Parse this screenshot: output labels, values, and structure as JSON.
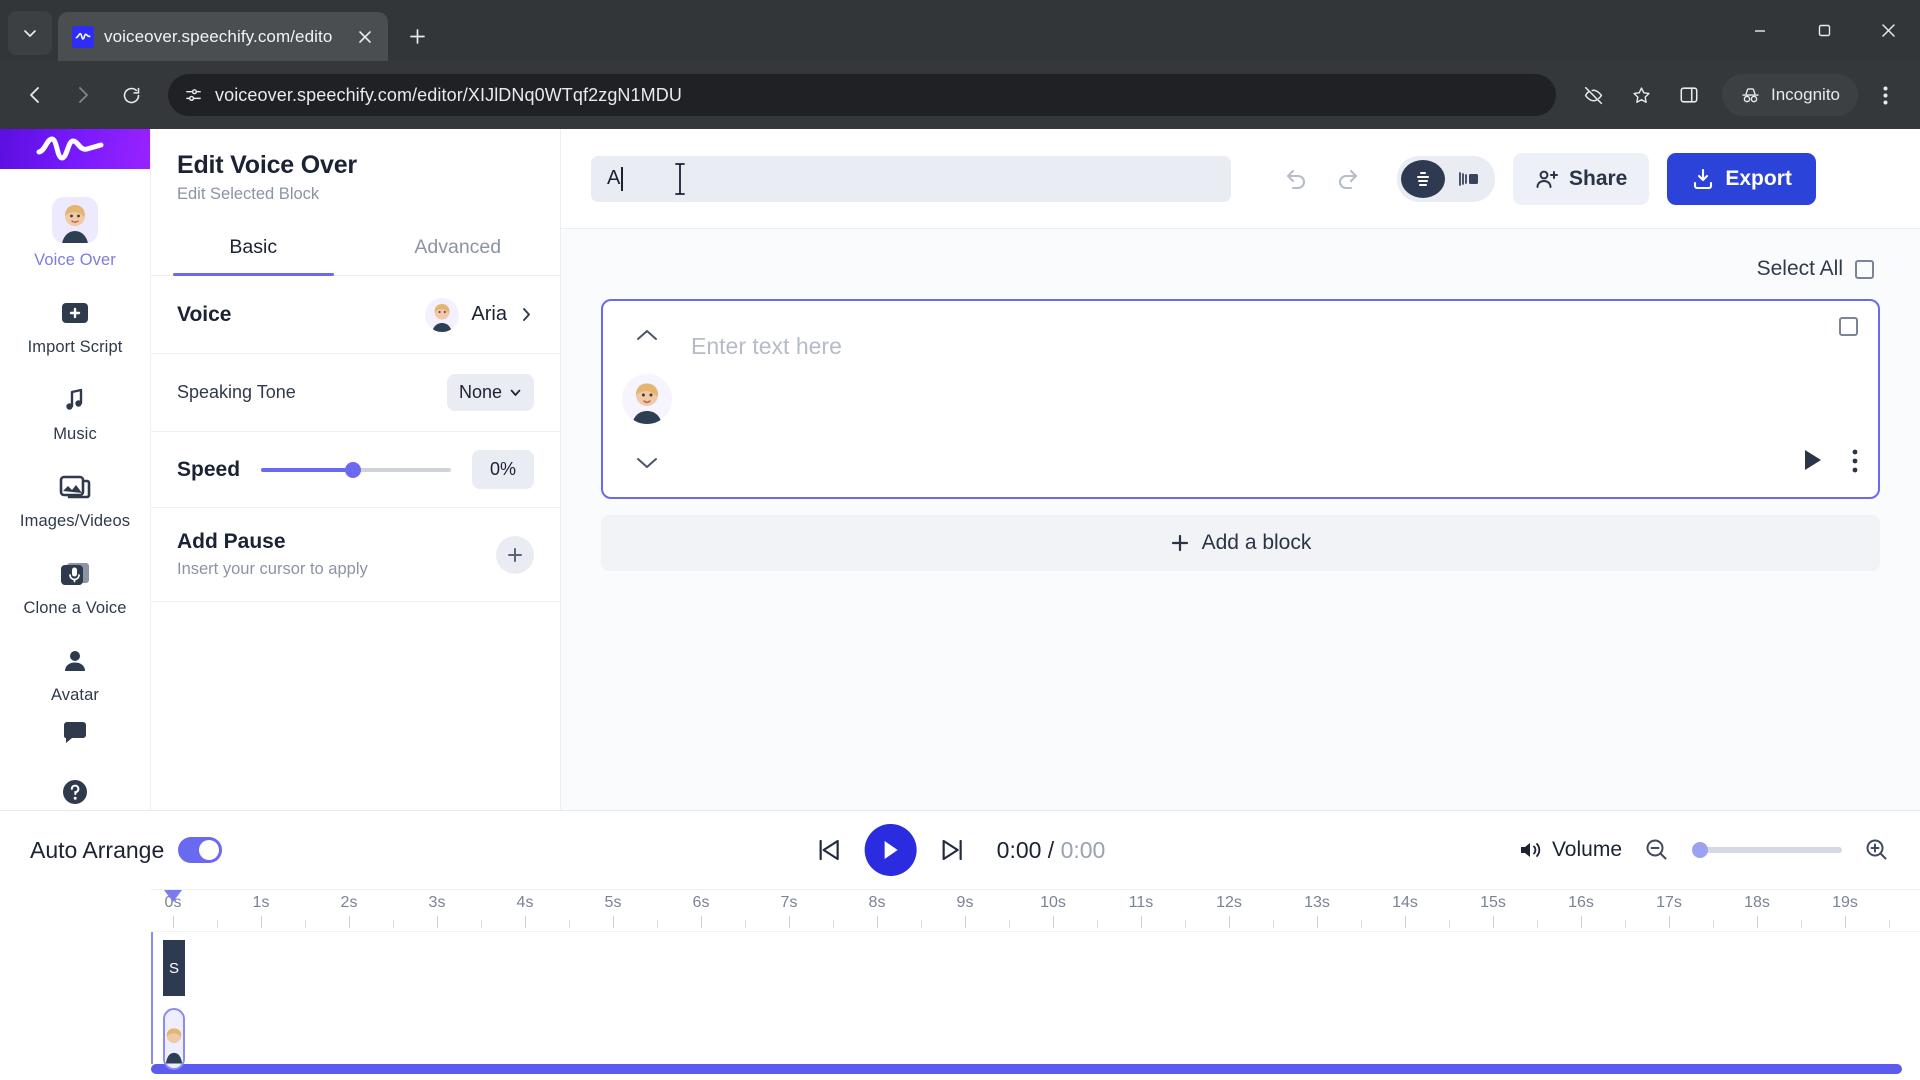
{
  "browser": {
    "tab": {
      "title": "voiceover.speechify.com/edito",
      "favicon": "speechify-logo-icon"
    },
    "url": "voiceover.speechify.com/editor/XIJlDNq0WTqf2zgN1MDU",
    "profile_label": "Incognito",
    "icons": {
      "tab_search": "chevron-down-icon",
      "new_tab": "plus-icon",
      "close_tab": "close-icon",
      "back": "back-arrow-icon",
      "forward": "forward-arrow-icon",
      "reload": "reload-icon",
      "site_info": "site-settings-icon",
      "third_party_cookies": "eye-off-icon",
      "bookmark": "star-icon",
      "side_panel": "side-panel-icon",
      "menu": "kebab-menu-icon",
      "minimize": "minimize-icon",
      "maximize": "maximize-icon",
      "window_close": "window-close-icon"
    }
  },
  "rail": {
    "logo": "speechify-wave-logo",
    "items": [
      {
        "label": "Voice Over",
        "icon": "voice-over-avatar-icon",
        "active": true
      },
      {
        "label": "Import Script",
        "icon": "plus-square-icon",
        "active": false
      },
      {
        "label": "Music",
        "icon": "music-note-icon",
        "active": false
      },
      {
        "label": "Images/Videos",
        "icon": "image-icon",
        "active": false
      },
      {
        "label": "Clone a Voice",
        "icon": "clone-voice-icon",
        "active": false
      },
      {
        "label": "Avatar",
        "icon": "person-icon",
        "active": false
      }
    ],
    "bottom": [
      {
        "icon": "chat-bubble-icon"
      },
      {
        "icon": "help-circle-icon"
      }
    ]
  },
  "panel": {
    "title": "Edit Voice Over",
    "subtitle": "Edit Selected Block",
    "tabs": [
      {
        "label": "Basic",
        "active": true
      },
      {
        "label": "Advanced",
        "active": false
      }
    ],
    "voice": {
      "label": "Voice",
      "value": "Aria",
      "chevron": "chevron-right-icon"
    },
    "speaking_tone": {
      "label": "Speaking Tone",
      "value": "None",
      "chevron": "chevron-down-icon"
    },
    "speed": {
      "label": "Speed",
      "value": "0%",
      "percent": 48
    },
    "add_pause": {
      "title": "Add Pause",
      "subtitle": "Insert your cursor to apply",
      "button_icon": "plus-icon"
    }
  },
  "toolbar": {
    "search_value": "A",
    "undo_icon": "undo-icon",
    "redo_icon": "redo-icon",
    "view_list_icon": "list-view-icon",
    "view_split_icon": "split-view-icon",
    "share_label": "Share",
    "share_icon": "share-person-icon",
    "export_label": "Export",
    "export_icon": "export-download-icon"
  },
  "canvas": {
    "select_all_label": "Select All",
    "block": {
      "placeholder": "Enter text here",
      "up_icon": "chevron-up-icon",
      "down_icon": "chevron-down-icon",
      "avatar_icon": "voice-avatar-icon",
      "play_icon": "play-icon",
      "more_icon": "more-vertical-icon",
      "checkbox_icon": "checkbox-empty-icon"
    },
    "add_block_label": "Add a block",
    "add_block_icon": "plus-icon"
  },
  "timeline": {
    "auto_arrange_label": "Auto Arrange",
    "auto_arrange_on": true,
    "skip_back_icon": "skip-back-icon",
    "play_icon": "play-icon",
    "skip_forward_icon": "skip-forward-icon",
    "current_time": "0:00",
    "separator": " / ",
    "total_time": "0:00",
    "volume_label": "Volume",
    "volume_icon": "volume-icon",
    "zoom_out_icon": "zoom-out-icon",
    "zoom_in_icon": "zoom-in-icon",
    "ticks": [
      "0s",
      "1s",
      "2s",
      "3s",
      "4s",
      "5s",
      "6s",
      "7s",
      "8s",
      "9s",
      "10s",
      "11s",
      "12s",
      "13s",
      "14s",
      "15s",
      "16s",
      "17s",
      "18s",
      "19s"
    ],
    "clip_text_label": "S"
  },
  "colors": {
    "accent": "#6a6af0",
    "export_blue": "#2b43d9",
    "play_blue": "#2b2be0",
    "logo_purple": "#7a1bff",
    "panel_border": "#eceef2"
  }
}
